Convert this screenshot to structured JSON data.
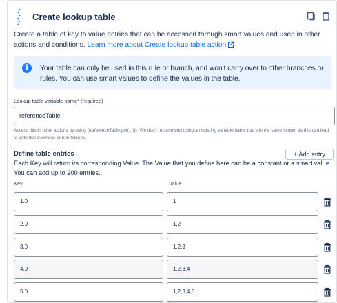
{
  "header": {
    "icon": "brackets-icon",
    "brackets_glyph": "{ }",
    "title": "Create lookup table"
  },
  "description": {
    "text": "Create a table of key to value entries that can be accessed through smart values and used in other actions and conditions.",
    "link_text": "Learn more about Create lookup table action"
  },
  "info_panel": {
    "icon_glyph": "i",
    "text": "Your table can only be used in this rule or branch, and won't carry over to other branches or rules. You can use smart values to define the values in the table."
  },
  "variable_name": {
    "label": "Lookup table variable name",
    "required_mark": "*",
    "required_text": "(required)",
    "value": "referenceTable",
    "helper": "Access this in other actions by using {{referenceTable.get(...)}}. We don't recommend using an existing variable name that's in the same scope, as this can lead to potential overrides or rule failures."
  },
  "entries": {
    "title": "Define table entries",
    "add_label": "+ Add entry",
    "description": "Each Key will return its corresponding Value. The Value that you define here can be a constant or a smart value. You can add up to 200 entries.",
    "key_header": "Key",
    "value_header": "Value",
    "rows": [
      {
        "key": "1.0",
        "value": "1"
      },
      {
        "key": "2.0",
        "value": "1,2"
      },
      {
        "key": "3.0",
        "value": "1,2,3"
      },
      {
        "key": "4.0",
        "value": "1,2,3,4"
      },
      {
        "key": "5.0",
        "value": "1,2,3,4,5"
      }
    ]
  },
  "colors": {
    "accent": "#0c66e4",
    "info_bg": "#e9f2ff",
    "info_icon": "#1d7afc",
    "highlight_row": "#f4f5f7"
  }
}
